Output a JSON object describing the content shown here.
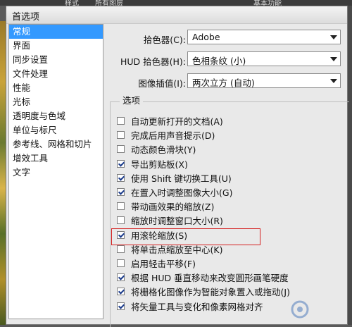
{
  "background": {
    "menu_fragments": [
      "样式",
      "所有图层",
      "基本功能"
    ]
  },
  "dialog": {
    "title": "首选项"
  },
  "sidebar": {
    "items": [
      {
        "label": "常规",
        "selected": true
      },
      {
        "label": "界面",
        "selected": false
      },
      {
        "label": "同步设置",
        "selected": false
      },
      {
        "label": "文件处理",
        "selected": false
      },
      {
        "label": "性能",
        "selected": false
      },
      {
        "label": "光标",
        "selected": false
      },
      {
        "label": "透明度与色域",
        "selected": false
      },
      {
        "label": "单位与标尺",
        "selected": false
      },
      {
        "label": "参考线、网格和切片",
        "selected": false
      },
      {
        "label": "增效工具",
        "selected": false
      },
      {
        "label": "文字",
        "selected": false
      }
    ]
  },
  "fields": {
    "color_picker": {
      "label": "拾色器(C):",
      "value": "Adobe"
    },
    "hud_color_picker": {
      "label": "HUD 拾色器(H):",
      "value": "色相条纹 (小)"
    },
    "image_interpolation": {
      "label": "图像插值(I):",
      "value": "两次立方 (自动)"
    }
  },
  "options": {
    "title": "选项",
    "items": [
      {
        "label": "自动更新打开的文档(A)",
        "checked": false
      },
      {
        "label": "完成后用声音提示(D)",
        "checked": false
      },
      {
        "label": "动态颜色滑块(Y)",
        "checked": false
      },
      {
        "label": "导出剪贴板(X)",
        "checked": true
      },
      {
        "label": "使用 Shift 键切换工具(U)",
        "checked": true
      },
      {
        "label": "在置入时调整图像大小(G)",
        "checked": true
      },
      {
        "label": "带动画效果的缩放(Z)",
        "checked": false
      },
      {
        "label": "缩放时调整窗口大小(R)",
        "checked": false
      },
      {
        "label": "用滚轮缩放(S)",
        "checked": true
      },
      {
        "label": "将单击点缩放至中心(K)",
        "checked": false
      },
      {
        "label": "启用轻击平移(F)",
        "checked": false
      },
      {
        "label": "根据 HUD 垂直移动来改变圆形画笔硬度",
        "checked": true
      },
      {
        "label": "将栅格化图像作为智能对象置入或拖动(J)",
        "checked": true
      },
      {
        "label": "将矢量工具与变化和像素网格对齐",
        "checked": true
      }
    ]
  },
  "colors": {
    "selection": "#3399ff",
    "highlight_box": "#d42020"
  }
}
